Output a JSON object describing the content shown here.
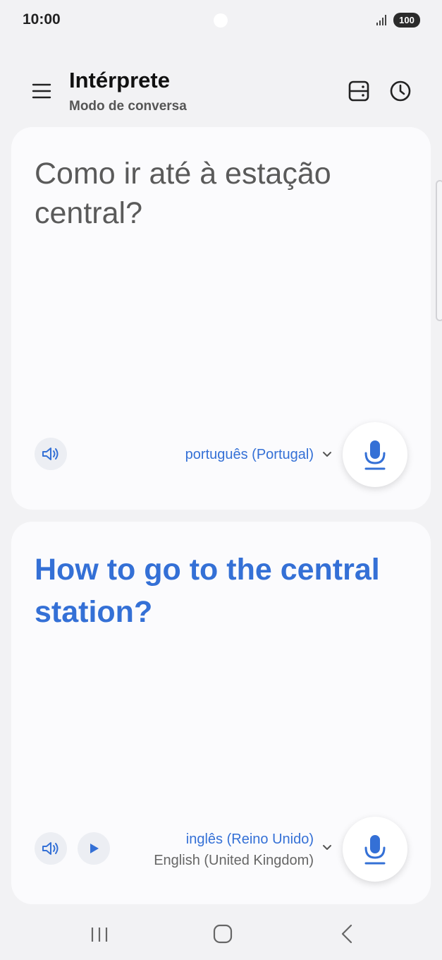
{
  "status_bar": {
    "time": "10:00",
    "battery": "100",
    "signal_icon": "signal-icon"
  },
  "header": {
    "title": "Intérprete",
    "subtitle": "Modo de conversa",
    "menu_icon": "hamburger-menu-icon",
    "layout_icon": "split-layout-icon",
    "history_icon": "history-clock-icon"
  },
  "source_card": {
    "text": "Como ir até à estação central?",
    "language": "português (Portugal)",
    "speaker_icon": "speaker-icon",
    "mic_icon": "microphone-icon"
  },
  "target_card": {
    "text": "How to go to the central station?",
    "language": "inglês (Reino Unido)",
    "language_native": "English (United Kingdom)",
    "speaker_icon": "speaker-icon",
    "play_icon": "play-icon",
    "mic_icon": "microphone-icon"
  },
  "colors": {
    "accent": "#3470d6",
    "background": "#f2f2f4",
    "card": "#fbfbfd",
    "source_text": "#5a5a5a"
  },
  "nav_bar": {
    "recent_icon": "recent-apps-icon",
    "home_icon": "home-icon",
    "back_icon": "back-icon"
  }
}
